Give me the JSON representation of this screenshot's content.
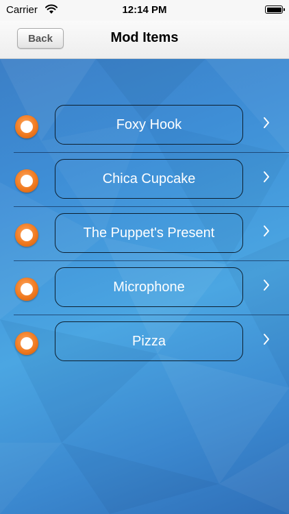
{
  "status_bar": {
    "carrier": "Carrier",
    "time": "12:14 PM"
  },
  "nav": {
    "back_label": "Back",
    "title": "Mod Items"
  },
  "items": [
    {
      "label": "Foxy Hook"
    },
    {
      "label": "Chica Cupcake"
    },
    {
      "label": "The Puppet's Present"
    },
    {
      "label": "Microphone"
    },
    {
      "label": "Pizza"
    }
  ],
  "colors": {
    "background_blue": "#3e8ed6",
    "radio_orange": "#f07a20",
    "button_border": "#0c1e2e"
  },
  "icons": {
    "row_indicator": "radio-button-icon",
    "row_accessory": "chevron-right-icon",
    "status_wifi": "wifi-icon",
    "status_battery": "battery-icon"
  }
}
